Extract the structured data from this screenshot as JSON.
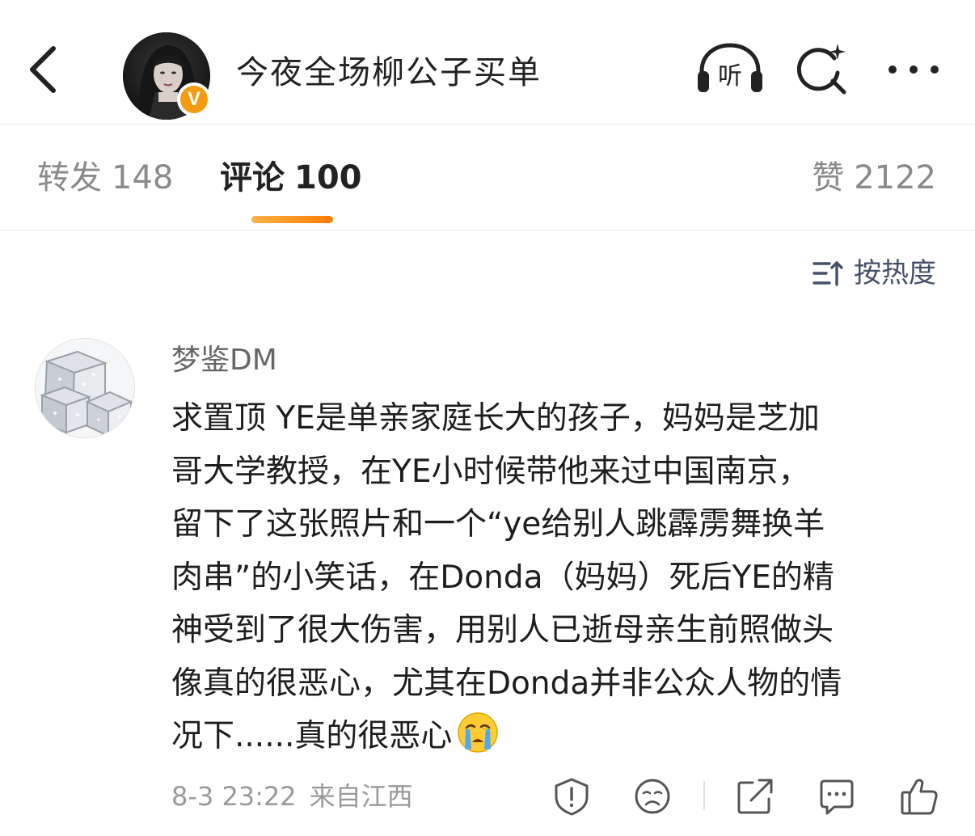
{
  "header": {
    "user_name": "今夜全场柳公子买单",
    "verified_badge_text": "V",
    "listen_icon_text": "听",
    "icons": [
      "back-icon",
      "listen-icon",
      "search-icon",
      "more-icon"
    ]
  },
  "tabs": {
    "reposts": {
      "label": "转发",
      "count": "148"
    },
    "comments": {
      "label": "评论",
      "count": "100",
      "active": true
    },
    "likes": {
      "label": "赞",
      "count": "2122"
    },
    "accent_color": "#ff8200"
  },
  "sort": {
    "label": "按热度",
    "icon": "sort-icon"
  },
  "comment": {
    "author": "梦鉴DM",
    "lines": [
      "求置顶 YE是单亲家庭长大的孩子，妈妈是芝加",
      "哥大学教授，在YE小时候带他来过中国南京，",
      "留下了这张照片和一个“ye给别人跳霹雳舞换羊",
      "肉串”的小笑话，在Donda（妈妈）死后YE的精",
      "神受到了很大伤害，用别人已逝母亲生前照做头",
      "像真的很恶心，尤其在Donda并非公众人物的情",
      "况下......真的很恶心"
    ],
    "emoji": "crying-emoji",
    "time": "8-3 23:22",
    "location": "来自江西",
    "actions": [
      "report-icon",
      "dislike-icon",
      "share-icon",
      "reply-icon",
      "like-icon"
    ]
  }
}
